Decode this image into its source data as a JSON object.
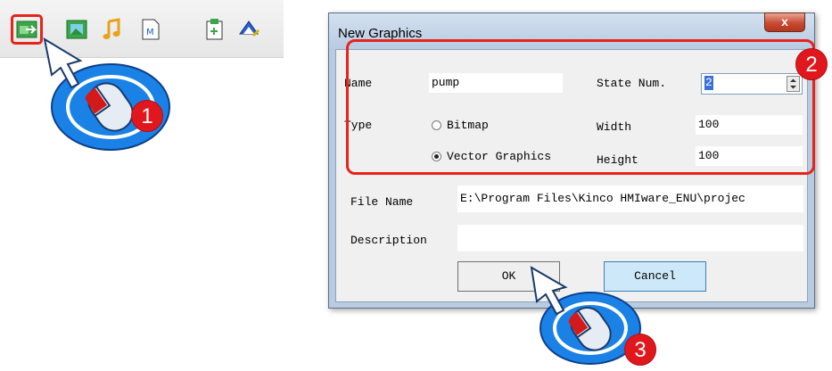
{
  "toolbar": {
    "icons": [
      "new-graphics-icon",
      "picture-icon",
      "music-note-icon",
      "document-m-icon",
      "clipboard-icon",
      "fill-tool-icon"
    ]
  },
  "dialog": {
    "title": "New Graphics",
    "close_label": "x",
    "name_label": "Name",
    "name_value": "pump",
    "state_num_label": "State Num.",
    "state_num_value": "2",
    "type_label": "Type",
    "type_options": [
      "Bitmap",
      "Vector Graphics"
    ],
    "type_selected": "Vector Graphics",
    "width_label": "Width",
    "width_value": "100",
    "height_label": "Height",
    "height_value": "100",
    "file_name_label": "File Name",
    "file_name_value": "E:\\Program Files\\Kinco HMIware_ENU\\projec",
    "description_label": "Description",
    "description_value": "",
    "ok_label": "OK",
    "cancel_label": "Cancel"
  },
  "callouts": [
    "1",
    "2",
    "3"
  ],
  "colors": {
    "callout_red": "#e0181e",
    "mouse_blue": "#1a82e6",
    "title_bar": "#b7cbe2",
    "cancel_button": "#cde8f8"
  }
}
